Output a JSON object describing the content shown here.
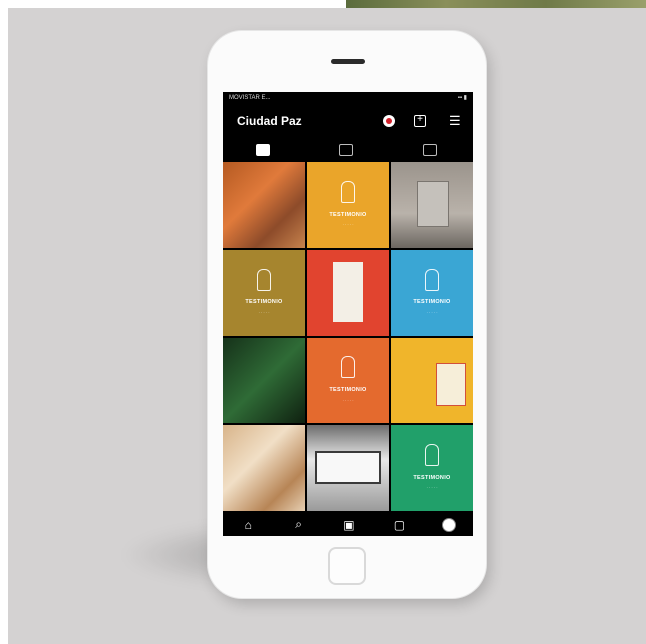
{
  "app": {
    "title": "Ciudad Paz"
  },
  "status_bar": {
    "carrier": "MOVISTAR E...",
    "right": "▪▪ ▮"
  },
  "header": {
    "menu_icon": "☰",
    "add_icon": "+"
  },
  "tabs": [
    {
      "name": "grid-tab",
      "active": true
    },
    {
      "name": "reels-tab",
      "active": false
    },
    {
      "name": "tagged-tab",
      "active": false
    }
  ],
  "grid": {
    "brand_text": "TESTIMONIO",
    "brand_sub": "· · · · ·",
    "tiles": [
      {
        "kind": "photo-orange"
      },
      {
        "kind": "brand",
        "color": "#eaa52a"
      },
      {
        "kind": "photo-machine"
      },
      {
        "kind": "brand",
        "color": "#a6852e"
      },
      {
        "kind": "poster-red"
      },
      {
        "kind": "brand",
        "color": "#3aa6d4"
      },
      {
        "kind": "photo-green"
      },
      {
        "kind": "brand",
        "color": "#e46a2e"
      },
      {
        "kind": "yellow-flyer"
      },
      {
        "kind": "photo-wood"
      },
      {
        "kind": "photo-sign"
      },
      {
        "kind": "brand",
        "color": "#21a06a"
      }
    ]
  },
  "bottom_nav": {
    "home_icon": "⌂",
    "search_icon": "⌕",
    "reels_icon": "▣",
    "shop_icon": "▢"
  },
  "colors": {
    "background": "#d4d2d2",
    "phone_body": "#fbfbfb",
    "screen": "#000000"
  }
}
